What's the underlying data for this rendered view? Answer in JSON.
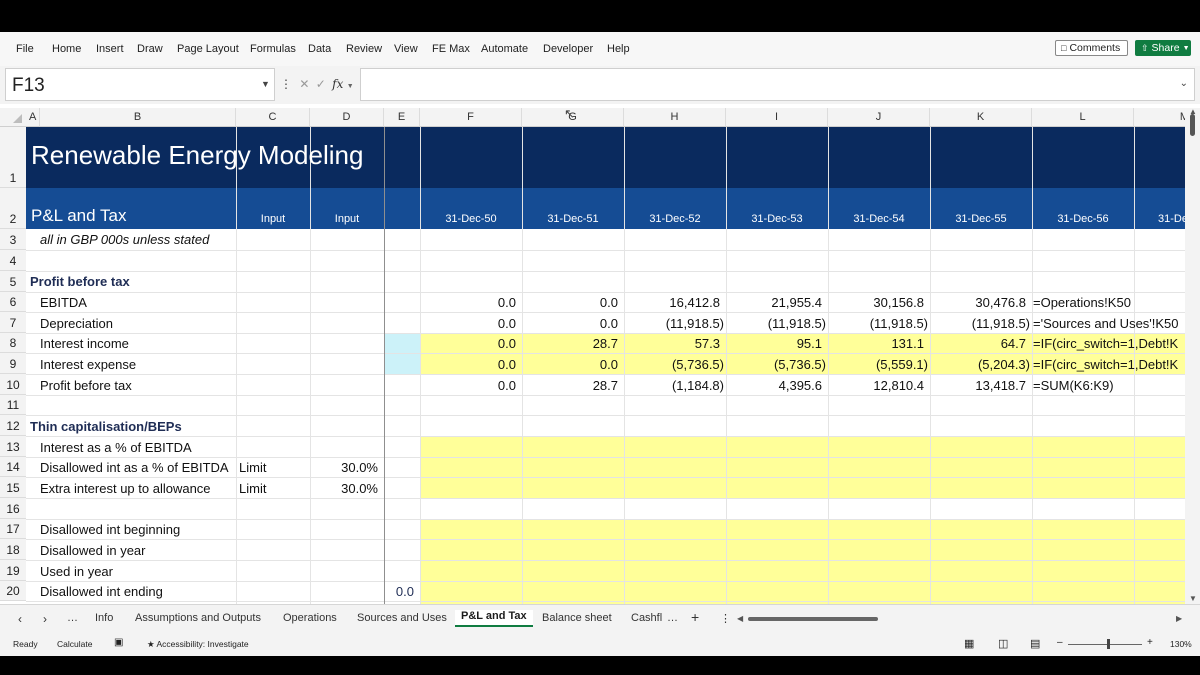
{
  "menu": [
    "File",
    "Home",
    "Insert",
    "Draw",
    "Page Layout",
    "Formulas",
    "Data",
    "Review",
    "View",
    "FE Max",
    "Automate",
    "Developer",
    "Help"
  ],
  "buttons": {
    "comments": "Comments",
    "share": "Share"
  },
  "formula_bar": {
    "name_box": "F13",
    "fx": "fx",
    "formula": ""
  },
  "columns": [
    "A",
    "B",
    "C",
    "D",
    "E",
    "F",
    "G",
    "H",
    "I",
    "J",
    "K",
    "L",
    "M"
  ],
  "rows": [
    "1",
    "2",
    "3",
    "4",
    "5",
    "6",
    "7",
    "8",
    "9",
    "10",
    "11",
    "12",
    "13",
    "14",
    "15",
    "16",
    "17",
    "18",
    "19",
    "20"
  ],
  "sheet": {
    "title": "Renewable Energy Modeling",
    "subtitle": "P&L and Tax",
    "input_c": "Input",
    "input_d": "Input",
    "dates": [
      "31-Dec-50",
      "31-Dec-51",
      "31-Dec-52",
      "31-Dec-53",
      "31-Dec-54",
      "31-Dec-55",
      "31-Dec-56",
      "31-De"
    ],
    "units_note": "all in GBP 000s unless stated",
    "section_pbt": "Profit before tax",
    "ebitda": {
      "label": "EBITDA",
      "values": [
        "0.0",
        "0.0",
        "16,412.8",
        "21,955.4",
        "30,156.8",
        "30,476.8"
      ],
      "formula": "=Operations!K50"
    },
    "depreciation": {
      "label": "Depreciation",
      "values": [
        "0.0",
        "0.0",
        "(11,918.5)",
        "(11,918.5)",
        "(11,918.5)",
        "(11,918.5)"
      ],
      "formula": "='Sources and Uses'!K50"
    },
    "interest_income": {
      "label": "Interest income",
      "values": [
        "0.0",
        "28.7",
        "57.3",
        "95.1",
        "131.1",
        "64.7"
      ],
      "formula": "=IF(circ_switch=1,Debt!K"
    },
    "interest_expense": {
      "label": "Interest expense",
      "values": [
        "0.0",
        "0.0",
        "(5,736.5)",
        "(5,736.5)",
        "(5,559.1)",
        "(5,204.3)"
      ],
      "formula": "=IF(circ_switch=1,Debt!K"
    },
    "pbt": {
      "label": "Profit before tax",
      "values": [
        "0.0",
        "28.7",
        "(1,184.8)",
        "4,395.6",
        "12,810.4",
        "13,418.7"
      ],
      "formula": "=SUM(K6:K9)"
    },
    "section_thin": "Thin capitalisation/BEPs",
    "int_pct_ebitda": "Interest as a % of EBITDA",
    "disallowed_pct": {
      "label": "Disallowed int as a % of EBITDA",
      "limit": "Limit",
      "value": "30.0%"
    },
    "extra_interest": {
      "label": "Extra interest up to allowance",
      "limit": "Limit",
      "value": "30.0%"
    },
    "disallowed_beginning": "Disallowed int beginning",
    "disallowed_year": "Disallowed in year",
    "used_year": "Used in year",
    "disallowed_ending": {
      "label": "Disallowed int ending",
      "value": "0.0"
    }
  },
  "tabs": {
    "more": "…",
    "items": [
      "Info",
      "Assumptions and Outputs",
      "Operations",
      "Sources and Uses",
      "P&L and Tax",
      "Balance sheet",
      "Cashfl"
    ],
    "active": "P&L and Tax",
    "add": "+"
  },
  "status": {
    "ready": "Ready",
    "calculate": "Calculate",
    "accessibility": "Accessibility: Investigate",
    "zoom": "130%"
  },
  "colors": {
    "navy": "#0a2a5e",
    "blue_band": "#154c94",
    "yellow": "#ffff99",
    "cyan": "#ccf2f9",
    "accent": "#107c41"
  }
}
